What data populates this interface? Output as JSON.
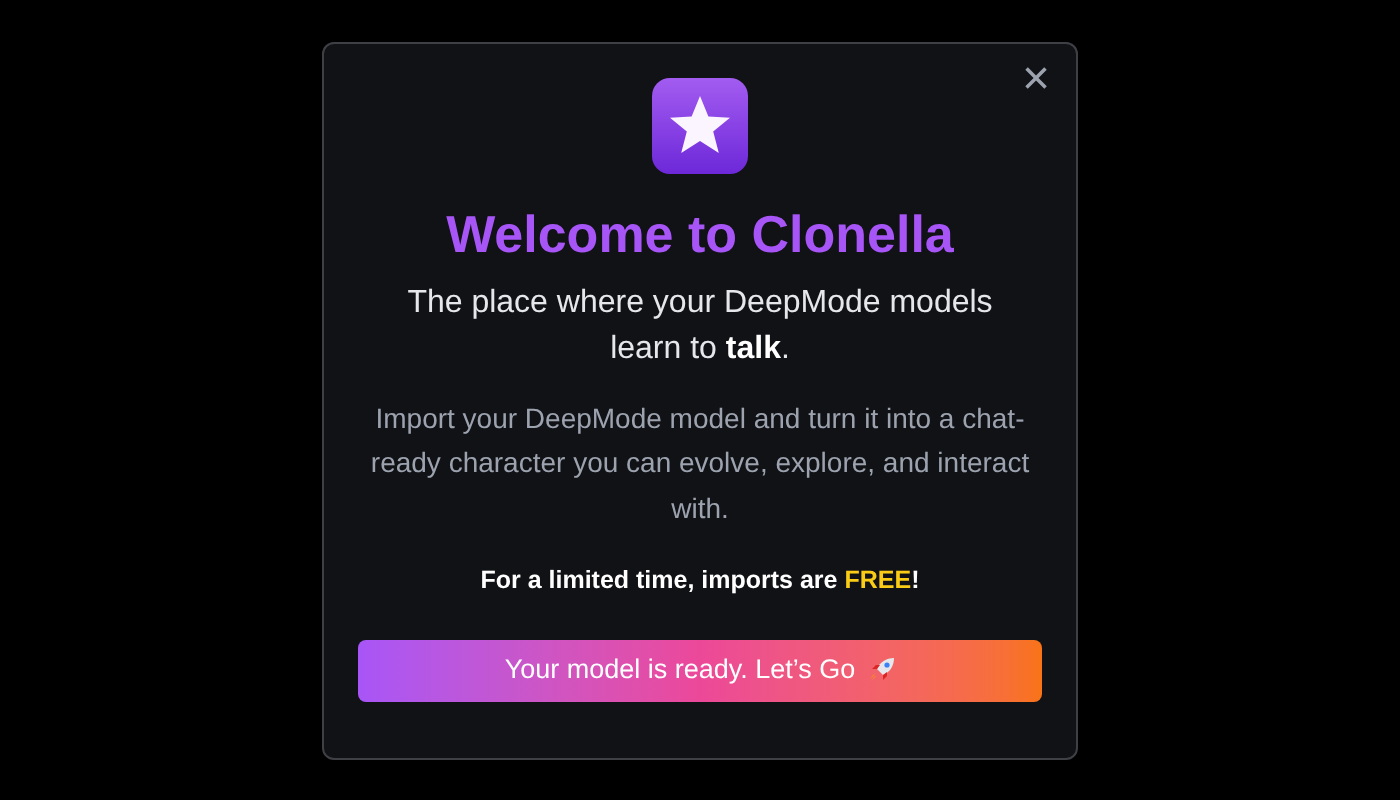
{
  "dialog": {
    "close_label": "×",
    "title": "Welcome to Clonella",
    "subtitle": "The place where your DeepMode models learn to **talk**.",
    "description": "Import your DeepMode model and turn it into a chat-ready character you can evolve, explore, and interact with.",
    "promo": {
      "before": "For a limited time, imports are ",
      "highlight": "FREE",
      "after": "!"
    },
    "button": "Your model is ready. Let’s Go"
  }
}
